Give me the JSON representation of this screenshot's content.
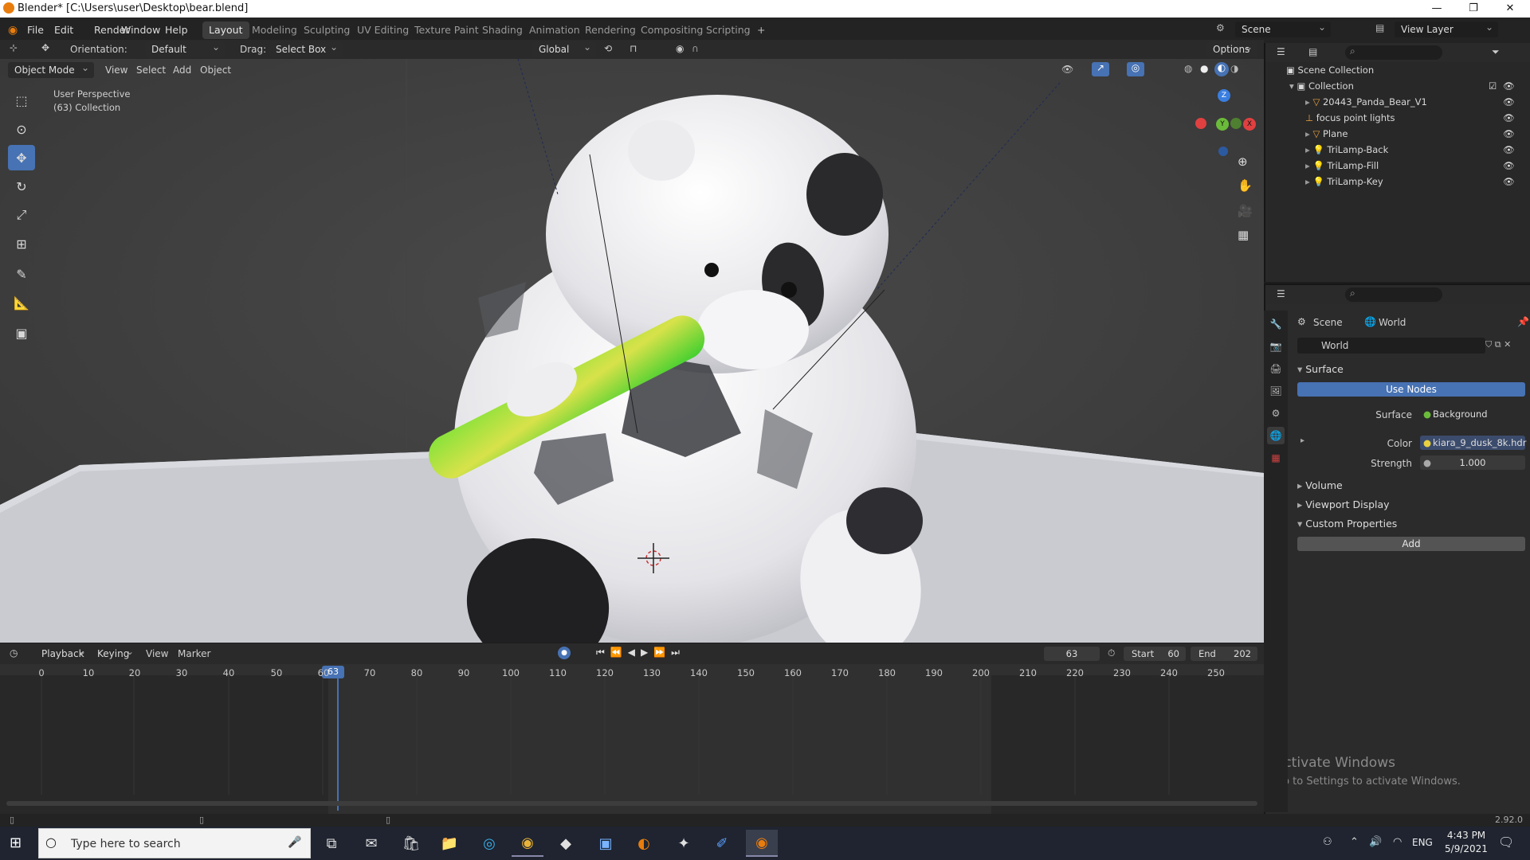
{
  "window": {
    "title": "Blender* [C:\\Users\\user\\Desktop\\bear.blend]",
    "controls": [
      "—",
      "❐",
      "✕"
    ]
  },
  "menu": [
    "File",
    "Edit",
    "Render",
    "Window",
    "Help"
  ],
  "workspaces": [
    "Layout",
    "Modeling",
    "Sculpting",
    "UV Editing",
    "Texture Paint",
    "Shading",
    "Animation",
    "Rendering",
    "Compositing",
    "Scripting",
    "+"
  ],
  "active_workspace": "Layout",
  "scene_field": "Scene",
  "view_layer_field": "View Layer",
  "tool_header": {
    "orientation_label": "Orientation:",
    "orientation_value": "Default",
    "drag_label": "Drag:",
    "drag_value": "Select Box",
    "transform_orientation": "Global",
    "options_label": "Options"
  },
  "viewport_header": {
    "mode": "Object Mode",
    "menus": [
      "View",
      "Select",
      "Add",
      "Object"
    ]
  },
  "viewport_overlay": {
    "line1": "User Perspective",
    "line2": "(63) Collection"
  },
  "gizmo_axes": {
    "z": "Z",
    "y": "Y",
    "x": "X"
  },
  "outliner": {
    "root": "Scene Collection",
    "collection": "Collection",
    "items": [
      {
        "name": "20443_Panda_Bear_V1",
        "icon": "mesh-icon",
        "expand": true
      },
      {
        "name": "focus point lights",
        "icon": "empty-icon",
        "expand": false
      },
      {
        "name": "Plane",
        "icon": "mesh-icon",
        "expand": true
      },
      {
        "name": "TriLamp-Back",
        "icon": "light-icon",
        "expand": true
      },
      {
        "name": "TriLamp-Fill",
        "icon": "light-icon",
        "expand": true
      },
      {
        "name": "TriLamp-Key",
        "icon": "light-icon",
        "expand": true
      }
    ]
  },
  "properties": {
    "breadcrumb_scene": "Scene",
    "breadcrumb_world": "World",
    "world_name": "World",
    "surface_section": "Surface",
    "use_nodes": "Use Nodes",
    "surface_label": "Surface",
    "surface_value": "Background",
    "color_label": "Color",
    "color_value": "kiara_9_dusk_8k.hdr",
    "strength_label": "Strength",
    "strength_value": "1.000",
    "volume": "Volume",
    "viewport_display": "Viewport Display",
    "custom_properties": "Custom Properties",
    "add_button": "Add"
  },
  "timeline": {
    "menus": [
      "Playback",
      "Keying",
      "View",
      "Marker"
    ],
    "current_frame": "63",
    "start_label": "Start",
    "start_value": "60",
    "end_label": "End",
    "end_value": "202",
    "ticks": [
      "0",
      "10",
      "20",
      "30",
      "40",
      "50",
      "60",
      "70",
      "80",
      "90",
      "100",
      "110",
      "120",
      "130",
      "140",
      "150",
      "160",
      "170",
      "180",
      "190",
      "200",
      "210",
      "220",
      "230",
      "240",
      "250"
    ],
    "playhead": "63"
  },
  "watermark": {
    "line1": "Activate Windows",
    "line2": "Go to Settings to activate Windows."
  },
  "version": "2.92.0",
  "taskbar": {
    "search_placeholder": "Type here to search",
    "lang": "ENG",
    "time": "4:43 PM",
    "date": "5/9/2021"
  },
  "colors": {
    "accent": "#4772b3",
    "orange": "#e87d0d",
    "axis_x": "#e04040",
    "axis_y": "#6bbb3a",
    "axis_z": "#3a7ee0"
  }
}
